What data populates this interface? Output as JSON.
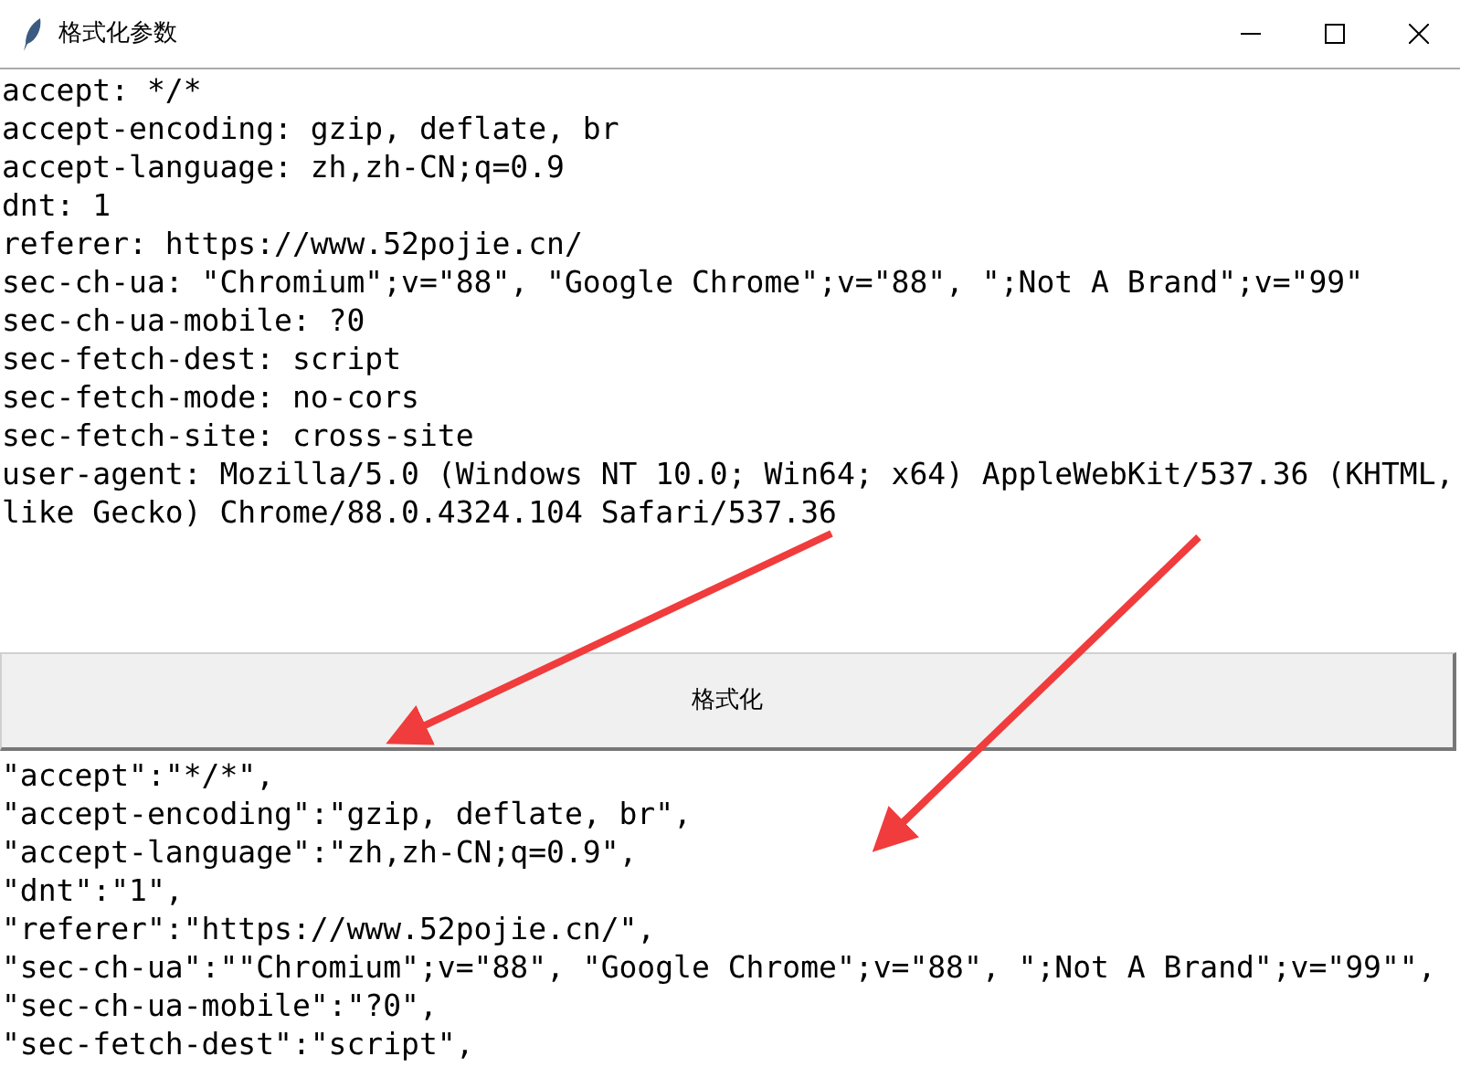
{
  "window": {
    "title": "格式化参数"
  },
  "input": {
    "lines": [
      "accept: */*",
      "accept-encoding: gzip, deflate, br",
      "accept-language: zh,zh-CN;q=0.9",
      "dnt: 1",
      "referer: https://www.52pojie.cn/",
      "sec-ch-ua: \"Chromium\";v=\"88\", \"Google Chrome\";v=\"88\", \";Not A Brand\";v=\"99\"",
      "sec-ch-ua-mobile: ?0",
      "sec-fetch-dest: script",
      "sec-fetch-mode: no-cors",
      "sec-fetch-site: cross-site",
      "user-agent: Mozilla/5.0 (Windows NT 10.0; Win64; x64) AppleWebKit/537.36 (KHTML, like Gecko) Chrome/88.0.4324.104 Safari/537.36"
    ]
  },
  "button": {
    "label": "格式化"
  },
  "output": {
    "lines": [
      "\"accept\":\"*/*\",",
      "\"accept-encoding\":\"gzip, deflate, br\",",
      "\"accept-language\":\"zh,zh-CN;q=0.9\",",
      "\"dnt\":\"1\",",
      "\"referer\":\"https://www.52pojie.cn/\",",
      "\"sec-ch-ua\":\"\"Chromium\";v=\"88\", \"Google Chrome\";v=\"88\", \";Not A Brand\";v=\"99\"\",",
      "\"sec-ch-ua-mobile\":\"?0\",",
      "\"sec-fetch-dest\":\"script\","
    ]
  }
}
